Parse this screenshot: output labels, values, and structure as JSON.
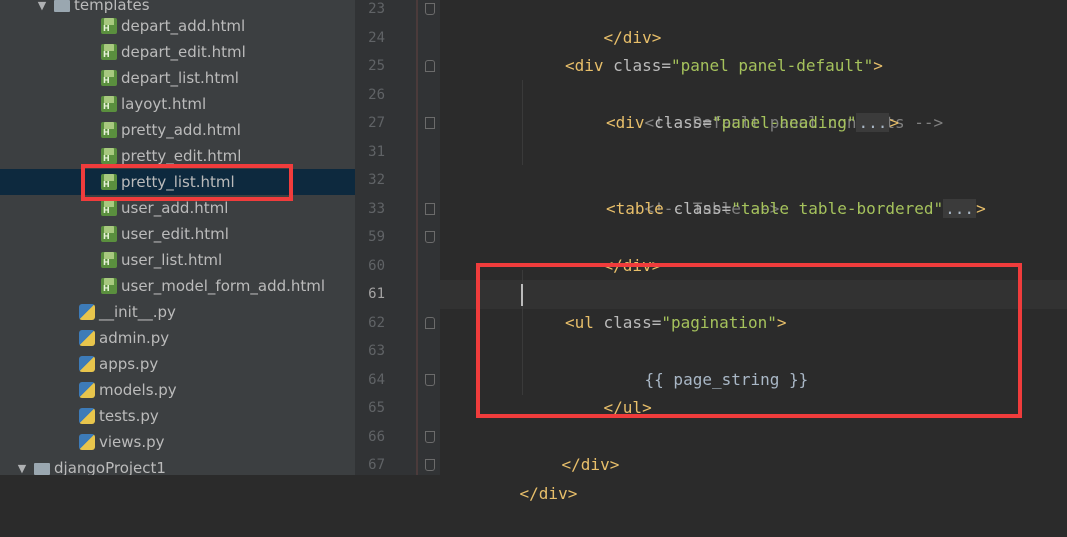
{
  "tree": {
    "folder_templates": "templates",
    "html_files": [
      "depart_add.html",
      "depart_edit.html",
      "depart_list.html",
      "layoyt.html",
      "pretty_add.html",
      "pretty_edit.html",
      "pretty_list.html",
      "user_add.html",
      "user_edit.html",
      "user_list.html",
      "user_model_form_add.html"
    ],
    "py_files": [
      "__init__.py",
      "admin.py",
      "apps.py",
      "models.py",
      "tests.py",
      "views.py"
    ],
    "project_folder": "djangoProject1",
    "selected": "pretty_list.html"
  },
  "editor": {
    "current_line": "61",
    "line_numbers": [
      "23",
      "24",
      "25",
      "26",
      "27",
      "31",
      "32",
      "33",
      "59",
      "60",
      "61",
      "62",
      "63",
      "64",
      "65",
      "66",
      "67"
    ],
    "lines": {
      "l23_tag": "</div>",
      "l25_open": "<div ",
      "l25_attr": "class=",
      "l25_val": "\"panel panel-default\"",
      "l25_close": ">",
      "l26_comment": "<!-- Default panel contents -->",
      "l27_open": "<div ",
      "l27_attr": "class=",
      "l27_val": "\"panel-heading\"",
      "l27_dots": "...",
      "l27_close": ">",
      "l32_comment": "<!-- Table -->",
      "l33_open": "<table ",
      "l33_attr": "class=",
      "l33_val": "\"table table-bordered\"",
      "l33_dots": "...",
      "l33_close": ">",
      "l59_tag": "</div>",
      "l62_open": "<ul ",
      "l62_attr": "class=",
      "l62_val": "\"pagination\"",
      "l62_close": ">",
      "l63_text": "{{ page_string }}",
      "l64_tag": "</ul>",
      "l66_tag": "</div>",
      "l67_tag": "</div>"
    }
  },
  "colors": {
    "highlight_box": "#f03c3c",
    "tag": "#e8bf6a",
    "string": "#a5c25c",
    "comment": "#808080"
  }
}
